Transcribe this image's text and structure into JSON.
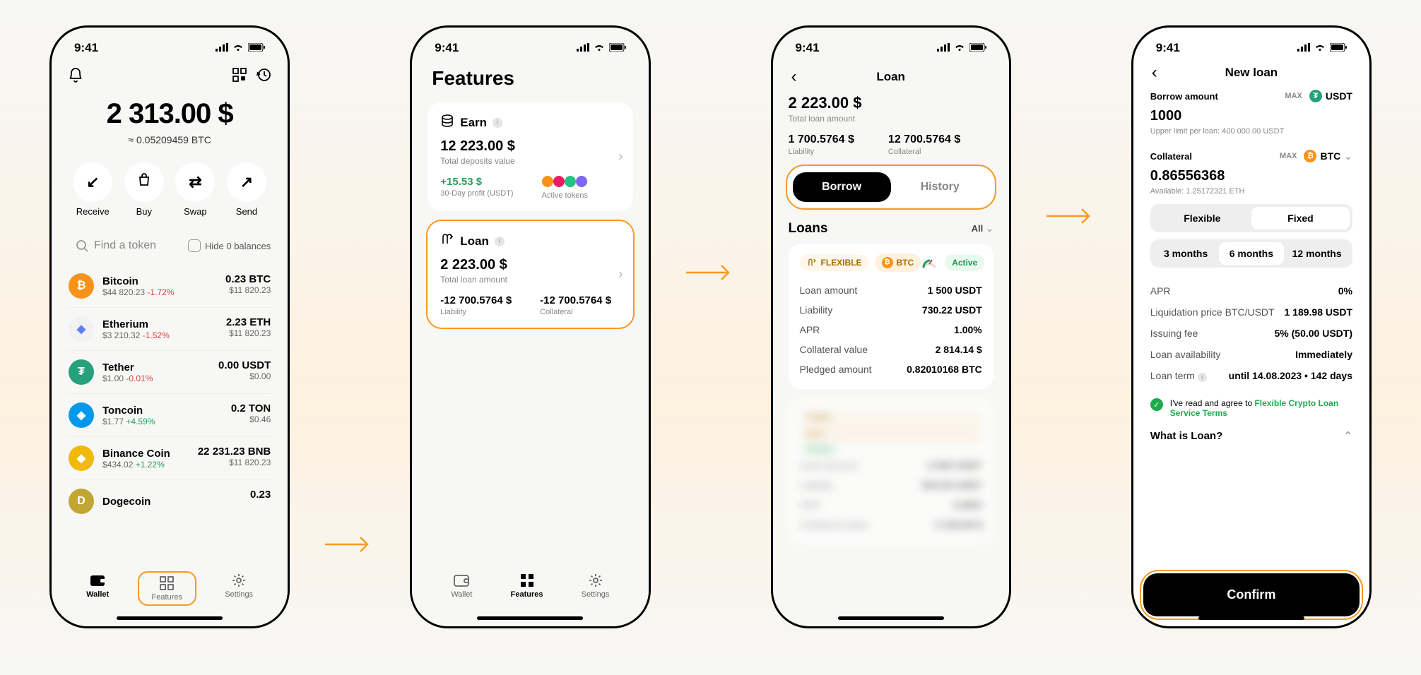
{
  "status_bar": {
    "time": "9:41"
  },
  "wallet": {
    "balance_main": "2 313.00 $",
    "balance_sub": "≈ 0.05209459 BTC",
    "actions": {
      "receive": "Receive",
      "buy": "Buy",
      "swap": "Swap",
      "send": "Send"
    },
    "search_placeholder": "Find a token",
    "hide_zero_label": "Hide 0 balances",
    "tokens": [
      {
        "name": "Bitcoin",
        "sub": "$44 820.23",
        "change": "-1.72%",
        "amount": "0.23 BTC",
        "value": "$11 820.23",
        "color": "#f7931a",
        "sym": "₿"
      },
      {
        "name": "Etherium",
        "sub": "$3 210.32",
        "change": "-1.52%",
        "amount": "2.23 ETH",
        "value": "$11 820.23",
        "color": "#627eea",
        "sym": "◆"
      },
      {
        "name": "Tether",
        "sub": "$1.00",
        "change": "-0.01%",
        "amount": "0.00 USDT",
        "value": "$0.00",
        "color": "#26a17b",
        "sym": "₮"
      },
      {
        "name": "Toncoin",
        "sub": "$1.77",
        "change": "+4.59%",
        "amount": "0.2 TON",
        "value": "$0.46",
        "color": "#0098ea",
        "sym": "◈"
      },
      {
        "name": "Binance Coin",
        "sub": "$434.02",
        "change": "+1.22%",
        "amount": "22 231.23 BNB",
        "value": "$11 820.23",
        "color": "#f0b90b",
        "sym": "◆"
      },
      {
        "name": "Dogecoin",
        "sub": "",
        "change": "",
        "amount": "0.23",
        "value": "",
        "color": "#c2a633",
        "sym": "D"
      }
    ],
    "tabbar": {
      "wallet": "Wallet",
      "features": "Features",
      "settings": "Settings"
    }
  },
  "features": {
    "title": "Features",
    "earn": {
      "name": "Earn",
      "value": "12 223.00 $",
      "sub": "Total deposits value",
      "profit": "+15.53 $",
      "profit_label": "30-Day profit (USDT)",
      "active_label": "Active tokens"
    },
    "loan": {
      "name": "Loan",
      "value": "2 223.00 $",
      "sub": "Total loan amount",
      "liability": "-12 700.5764 $",
      "liability_label": "Liability",
      "collateral": "-12 700.5764 $",
      "collateral_label": "Collateral"
    }
  },
  "loan_screen": {
    "title": "Loan",
    "total": "2 223.00 $",
    "total_label": "Total loan amount",
    "liability": "1 700.5764 $",
    "liability_label": "Liability",
    "collateral": "12 700.5764 $",
    "collateral_label": "Collateral",
    "borrow_btn": "Borrow",
    "history_btn": "History",
    "loans_title": "Loans",
    "all_label": "All",
    "loan_item": {
      "type_badge": "FLEXIBLE",
      "coin_badge": "BTC",
      "status_badge": "Active",
      "loan_amount_label": "Loan amount",
      "loan_amount_value": "1 500 USDT",
      "liability_label": "Liability",
      "liability_value": "730.22 USDT",
      "apr_label": "APR",
      "apr_value": "1.00%",
      "collateral_value_label": "Collateral value",
      "collateral_value_value": "2 814.14 $",
      "pledged_label": "Pledged amount",
      "pledged_value": "0.82010168 BTC"
    }
  },
  "new_loan": {
    "title": "New loan",
    "borrow_label": "Borrow amount",
    "max": "MAX",
    "usdt_label": "USDT",
    "borrow_value": "1000",
    "borrow_limit": "Upper limit per loan: 400 000.00 USDT",
    "collateral_label": "Collateral",
    "btc_label": "BTC",
    "collateral_value": "0.86556368",
    "available_note": "Available: 1.25172321 ETH",
    "seg_flexible": "Flexible",
    "seg_fixed": "Fixed",
    "term_3m": "3 months",
    "term_6m": "6 months",
    "term_12m": "12 months",
    "details": {
      "apr_label": "APR",
      "apr_value": "0%",
      "liq_label": "Liquidation price BTC/USDT",
      "liq_value": "1 189.98 USDT",
      "fee_label": "Issuing fee",
      "fee_value": "5% (50.00 USDT)",
      "avail_label": "Loan availability",
      "avail_value": "Immediately",
      "term_label": "Loan term",
      "term_value": "until 14.08.2023 • 142 days"
    },
    "agree_text": "I've read and agree to ",
    "agree_link": "Flexible Crypto Loan Service Terms",
    "faq_title": "What is Loan?",
    "confirm": "Confirm"
  }
}
